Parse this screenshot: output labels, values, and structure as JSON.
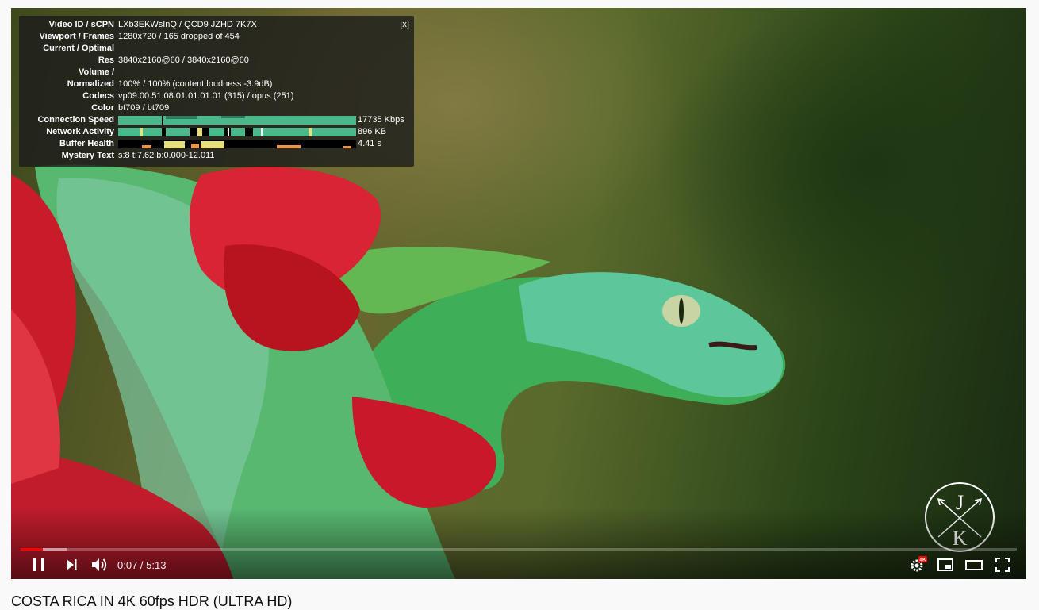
{
  "stats": {
    "close_label": "[x]",
    "rows": [
      {
        "label": "Video ID / sCPN",
        "value": "LXb3EKWsInQ / QCD9 JZHD 7K7X"
      },
      {
        "label": "Viewport / Frames",
        "value": "1280x720 / 165 dropped of 454"
      },
      {
        "label": "Current / Optimal",
        "value": ""
      },
      {
        "label": "Res",
        "value": "3840x2160@60 / 3840x2160@60"
      },
      {
        "label": "Volume /",
        "value": ""
      },
      {
        "label": "Normalized",
        "value": "100% / 100% (content loudness -3.9dB)"
      },
      {
        "label": "Codecs",
        "value": "vp09.00.51.08.01.01.01.01 (315) / opus (251)"
      },
      {
        "label": "Color",
        "value": "bt709 / bt709"
      },
      {
        "label": "Connection Speed",
        "value": "17735 Kbps"
      },
      {
        "label": "Network Activity",
        "value": "896 KB"
      },
      {
        "label": "Buffer Health",
        "value": "4.41 s"
      },
      {
        "label": "Mystery Text",
        "value": "s:8 t:7.62 b:0.000-12.011"
      }
    ]
  },
  "player": {
    "current_time": "0:07",
    "duration": "5:13",
    "time_display": "0:07 / 5:13",
    "played_fraction": 0.022,
    "buffered_fraction": 0.047,
    "quality_badge": "4K",
    "watermark_letters": [
      "J",
      "K"
    ]
  },
  "below_title": "COSTA RICA IN 4K 60fps HDR (ULTRA HD)",
  "colors": {
    "progress_played": "#ff0000",
    "graph_green": "#4ab88a",
    "graph_yellow": "#e8e07a",
    "graph_orange": "#e9954a"
  }
}
